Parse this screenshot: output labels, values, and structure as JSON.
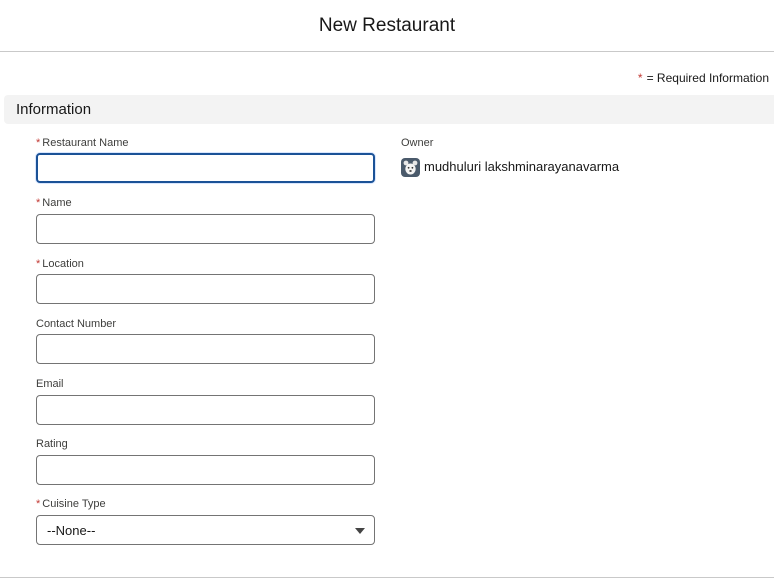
{
  "header": {
    "title": "New Restaurant"
  },
  "legend": {
    "star": "*",
    "text": "= Required Information"
  },
  "section": {
    "title": "Information"
  },
  "fields": {
    "restaurant_name": {
      "label": "Restaurant Name",
      "required": true,
      "value": ""
    },
    "name": {
      "label": "Name",
      "required": true,
      "value": ""
    },
    "location": {
      "label": "Location",
      "required": true,
      "value": ""
    },
    "contact_number": {
      "label": "Contact Number",
      "required": false,
      "value": ""
    },
    "email": {
      "label": "Email",
      "required": false,
      "value": ""
    },
    "rating": {
      "label": "Rating",
      "required": false,
      "value": ""
    },
    "cuisine_type": {
      "label": "Cuisine Type",
      "required": true,
      "value": "--None--"
    }
  },
  "owner": {
    "label": "Owner",
    "name": "mudhuluri lakshminarayanavarma",
    "avatar_icon": "user-avatar-icon"
  },
  "colors": {
    "required": "#c23934",
    "focus_border": "#1b5297",
    "section_bg": "#f3f3f3"
  }
}
